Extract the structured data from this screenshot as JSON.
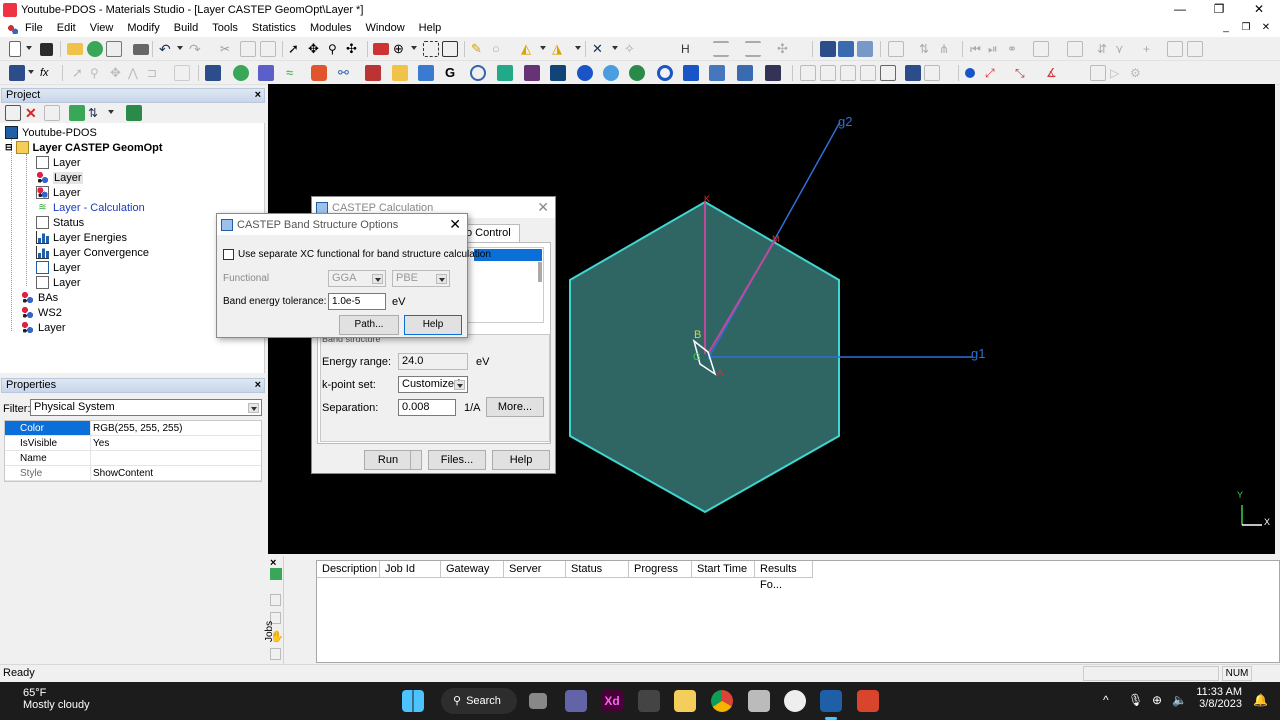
{
  "window": {
    "title": "Youtube-PDOS - Materials Studio - [Layer CASTEP GeomOpt\\Layer *]",
    "minimize": "—",
    "maximize": "❐",
    "close": "✕",
    "mdi_minimize": "_",
    "mdi_restore": "❐",
    "mdi_close": "✕"
  },
  "menu": [
    "File",
    "Edit",
    "View",
    "Modify",
    "Build",
    "Tools",
    "Statistics",
    "Modules",
    "Window",
    "Help"
  ],
  "project": {
    "header": "Project",
    "close": "×",
    "tree": [
      {
        "label": "Youtube-PDOS",
        "icon": "workspace-icon",
        "bold": false
      },
      {
        "label": "Layer CASTEP GeomOpt",
        "icon": "folder-icon",
        "bold": true
      },
      {
        "label": "Layer",
        "icon": "document-icon"
      },
      {
        "label": "Layer",
        "icon": "molecule-icon",
        "selected": true
      },
      {
        "label": "Layer",
        "icon": "structure-icon"
      },
      {
        "label": "Layer - Calculation",
        "icon": "calculation-icon",
        "link": true
      },
      {
        "label": "Status",
        "icon": "document-icon"
      },
      {
        "label": "Layer Energies",
        "icon": "chart-icon"
      },
      {
        "label": "Layer Convergence",
        "icon": "chart-icon"
      },
      {
        "label": "Layer",
        "icon": "document-icon"
      },
      {
        "label": "Layer",
        "icon": "document-icon"
      },
      {
        "label": "BAs",
        "icon": "molecule-icon"
      },
      {
        "label": "WS2",
        "icon": "molecule-icon"
      },
      {
        "label": "Layer",
        "icon": "molecule-icon"
      }
    ]
  },
  "properties": {
    "header": "Properties",
    "close": "×",
    "filter_label": "Filter:",
    "filter_value": "Physical System",
    "rows": [
      {
        "name": "Color",
        "value": "RGB(255, 255, 255)",
        "selected": true
      },
      {
        "name": "IsVisible",
        "value": "Yes"
      },
      {
        "name": "Name",
        "value": ""
      },
      {
        "name": "Style",
        "value": "ShowContent"
      }
    ]
  },
  "viewport": {
    "bg": "#000000",
    "hex_fill": "#2f6664",
    "hex_stroke": "#3fd6d0",
    "labels": {
      "g1": "g1",
      "g2": "g2",
      "K": "K",
      "M": "M",
      "B": "B",
      "A": "A",
      "G": "G",
      "axis_y": "Y",
      "axis_x": "X"
    }
  },
  "castep_dialog": {
    "title": "CASTEP Calculation",
    "close": "✕",
    "tab_control": "o Control",
    "section_band": "Band structure",
    "energy_range_label": "Energy range:",
    "energy_range_value": "24.0",
    "energy_unit": "eV",
    "kpoint_label": "k-point set:",
    "kpoint_value": "Customized",
    "separation_label": "Separation:",
    "separation_value": "0.008",
    "separation_unit": "1/A",
    "more_button": "More...",
    "run_button": "Run",
    "files_button": "Files...",
    "help_button": "Help"
  },
  "band_dialog": {
    "title": "CASTEP Band Structure Options",
    "close": "✕",
    "checkbox_label": "Use separate XC functional for band structure calculation",
    "checkbox_checked": false,
    "functional_label": "Functional",
    "functional_value": "GGA",
    "functional_sub_value": "PBE",
    "tolerance_label": "Band energy tolerance:",
    "tolerance_value": "1.0e-5",
    "tolerance_unit": "eV",
    "path_button": "Path...",
    "help_button": "Help"
  },
  "jobs": {
    "side_label": "Jobs",
    "close": "×",
    "columns": [
      "Description",
      "Job Id",
      "Gateway",
      "Server",
      "Status",
      "Progress",
      "Start Time",
      "Results Fo..."
    ]
  },
  "statusbar": {
    "left": "Ready",
    "num": "NUM"
  },
  "taskbar": {
    "weather_temp": "65°F",
    "weather_desc": "Mostly cloudy",
    "search_label": "Search",
    "time": "11:33 AM",
    "date": "3/8/2023",
    "caret": "^"
  }
}
